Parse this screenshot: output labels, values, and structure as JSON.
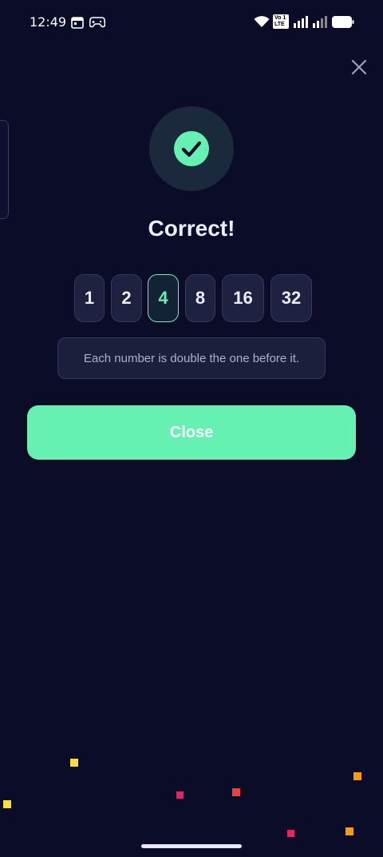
{
  "status_bar": {
    "time": "12:49",
    "icons": [
      "calendar-icon",
      "gamepad-icon",
      "wifi-icon",
      "volte-icon",
      "signal-icon",
      "signal-weak-icon",
      "battery-icon"
    ],
    "volte_top": "Vo 1",
    "volte_bottom": "LTE"
  },
  "dialog": {
    "title": "Correct!",
    "sequence": [
      "1",
      "2",
      "4",
      "8",
      "16",
      "32"
    ],
    "active_index": 2,
    "hint": "Each number is double the one before it.",
    "close_label": "Close"
  },
  "colors": {
    "background": "#0b0d28",
    "accent": "#66f0b2",
    "tile": "#1e2140",
    "confetti": [
      "#f5e03a",
      "#e8245b",
      "#e8453a",
      "#f59a1a"
    ]
  }
}
